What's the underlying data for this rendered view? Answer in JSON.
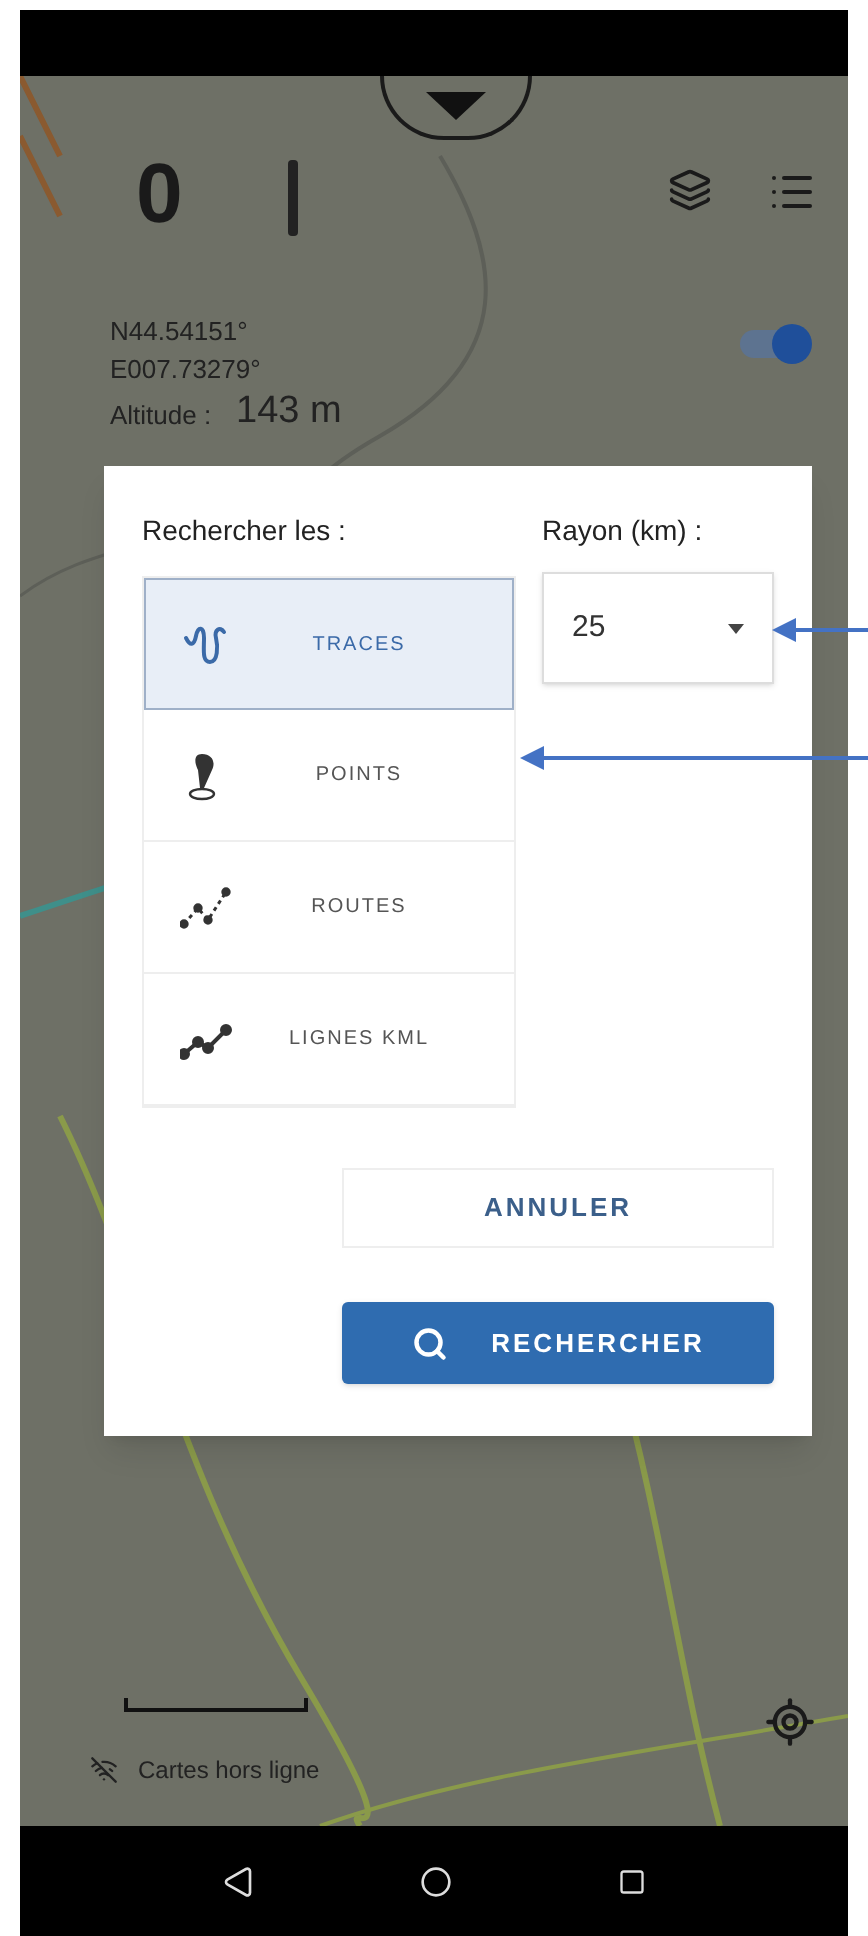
{
  "map": {
    "speed": "0",
    "latitude": "N44.54151°",
    "longitude": "E007.73279°",
    "altitude_label": "Altitude :",
    "altitude_value": "143 m",
    "offline_label": "Cartes hors ligne",
    "toggle": {
      "on": true
    }
  },
  "dialog": {
    "search_label": "Rechercher les :",
    "radius_label": "Rayon (km) :",
    "radius_value": "25",
    "types": [
      {
        "kind": "traces",
        "label": "TRACES",
        "selected": true
      },
      {
        "kind": "points",
        "label": "POINTS",
        "selected": false
      },
      {
        "kind": "routes",
        "label": "ROUTES",
        "selected": false
      },
      {
        "kind": "kml",
        "label": "LIGNES KML",
        "selected": false
      }
    ],
    "cancel_button": "ANNULER",
    "search_button": "RECHERCHER"
  }
}
